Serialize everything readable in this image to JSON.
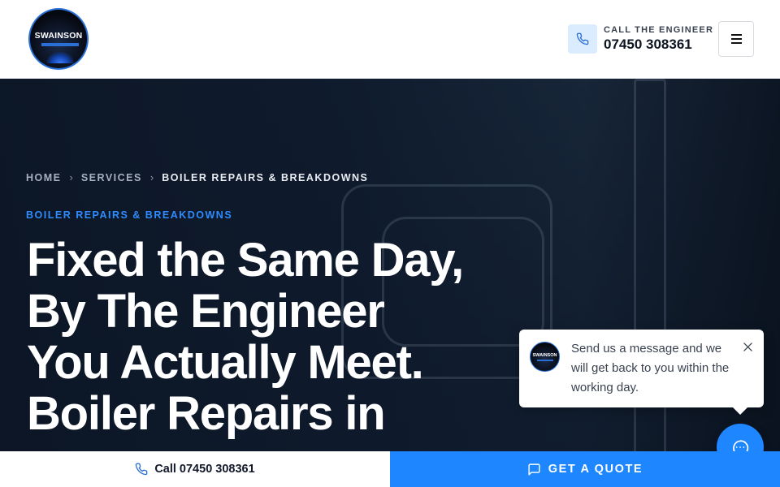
{
  "header": {
    "logo_text": "SWAINSON",
    "call_label": "CALL THE ENGINEER",
    "call_number": "07450 308361",
    "menu_icon": "hamburger-icon",
    "phone_icon": "phone-icon"
  },
  "breadcrumb": {
    "items": [
      "HOME",
      "SERVICES",
      "BOILER REPAIRS & BREAKDOWNS"
    ],
    "separator": "›"
  },
  "hero": {
    "eyebrow": "BOILER REPAIRS & BREAKDOWNS",
    "headline_lines": [
      "Fixed the Same Day,",
      "By The Engineer",
      "You Actually Meet.",
      "Boiler Repairs in"
    ]
  },
  "chat": {
    "avatar_text": "SWAINSON",
    "message": "Send us a message and we will get back to you within the working day.",
    "close_icon": "close-icon",
    "fab_icon": "chat-bubble-icon"
  },
  "bottom_bar": {
    "call_text": "Call 07450 308361",
    "quote_text": "GET A QUOTE"
  },
  "colors": {
    "accent": "#1e86ff",
    "eyebrow": "#2f8cff",
    "hero_bg": "#0e1a2b",
    "phone_badge_bg": "#dcecff"
  }
}
